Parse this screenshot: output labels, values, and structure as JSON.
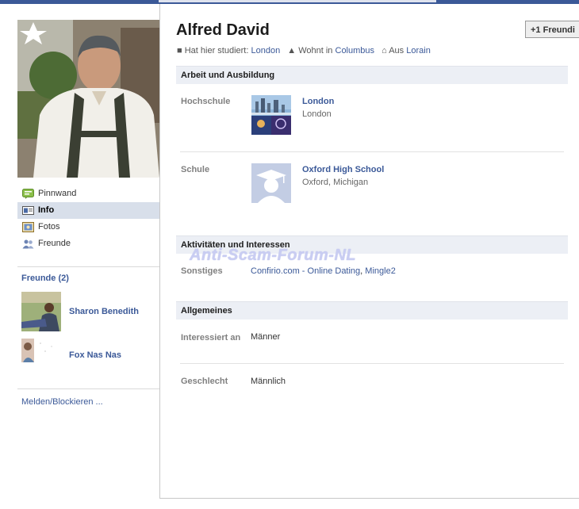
{
  "profile": {
    "name": "Alfred David",
    "add_friend_label": "Freundi",
    "meta": {
      "studied_prefix": "Hat hier studiert:",
      "studied_value": "London",
      "lives_prefix": "Wohnt in",
      "lives_value": "Columbus",
      "from_prefix": "Aus",
      "from_value": "Lorain"
    }
  },
  "nav": {
    "items": [
      {
        "label": "Pinnwand",
        "icon": "wall-icon"
      },
      {
        "label": "Info",
        "icon": "info-icon",
        "active": true
      },
      {
        "label": "Fotos",
        "icon": "photos-icon"
      },
      {
        "label": "Freunde",
        "icon": "friends-icon"
      }
    ]
  },
  "friends": {
    "heading": "Freunde (2)",
    "list": [
      {
        "name": "Sharon Benedith"
      },
      {
        "name": "Fox Nas Nas"
      }
    ]
  },
  "report_link": "Melden/Blockieren ...",
  "work_education": {
    "heading": "Arbeit und Ausbildung",
    "college_label": "Hochschule",
    "college_name": "London",
    "college_sub": "London",
    "school_label": "Schule",
    "school_name": "Oxford High School",
    "school_sub": "Oxford, Michigan"
  },
  "activities": {
    "heading": "Aktivitäten und Interessen",
    "other_label": "Sonstiges",
    "other_items": [
      "Confirio.com - Online Dating",
      "Mingle2"
    ],
    "other_separator": ", "
  },
  "general": {
    "heading": "Allgemeines",
    "interested_label": "Interessiert an",
    "interested_value": "Männer",
    "gender_label": "Geschlecht",
    "gender_value": "Männlich"
  },
  "watermark": "Anti-Scam-Forum-NL",
  "colors": {
    "brand": "#3b5998",
    "section_bg": "#eceff5",
    "active_nav_bg": "#d8dfea",
    "watermark": "#c9cdf2"
  }
}
